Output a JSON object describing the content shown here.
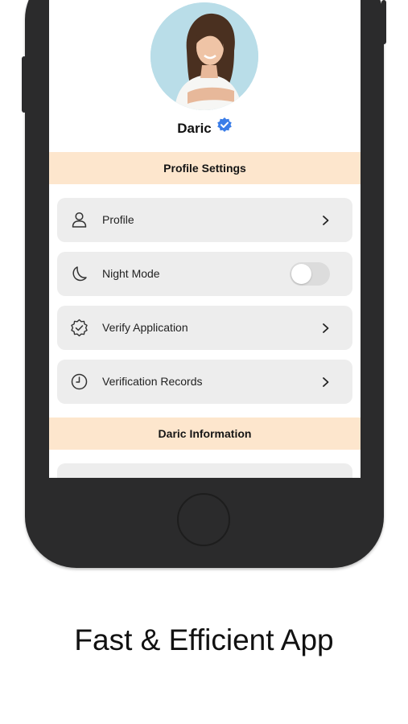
{
  "profile": {
    "name": "Daric",
    "verified": true,
    "verified_color": "#3a7de8"
  },
  "sections": {
    "profile_settings": "Profile Settings",
    "daric_information": "Daric Information"
  },
  "menu": {
    "items": [
      {
        "label": "Profile",
        "icon": "user-icon",
        "control": "chevron"
      },
      {
        "label": "Night Mode",
        "icon": "moon-icon",
        "control": "toggle",
        "toggle_on": false
      },
      {
        "label": "Verify Application",
        "icon": "verified-badge-icon",
        "control": "chevron"
      },
      {
        "label": "Verification Records",
        "icon": "clock-icon",
        "control": "chevron"
      }
    ]
  },
  "caption": "Fast & Efficient App",
  "colors": {
    "section_header_bg": "#fde6cd",
    "menu_item_bg": "#ededed",
    "phone_body": "#2b2b2c",
    "avatar_bg": "#b9dde8"
  }
}
